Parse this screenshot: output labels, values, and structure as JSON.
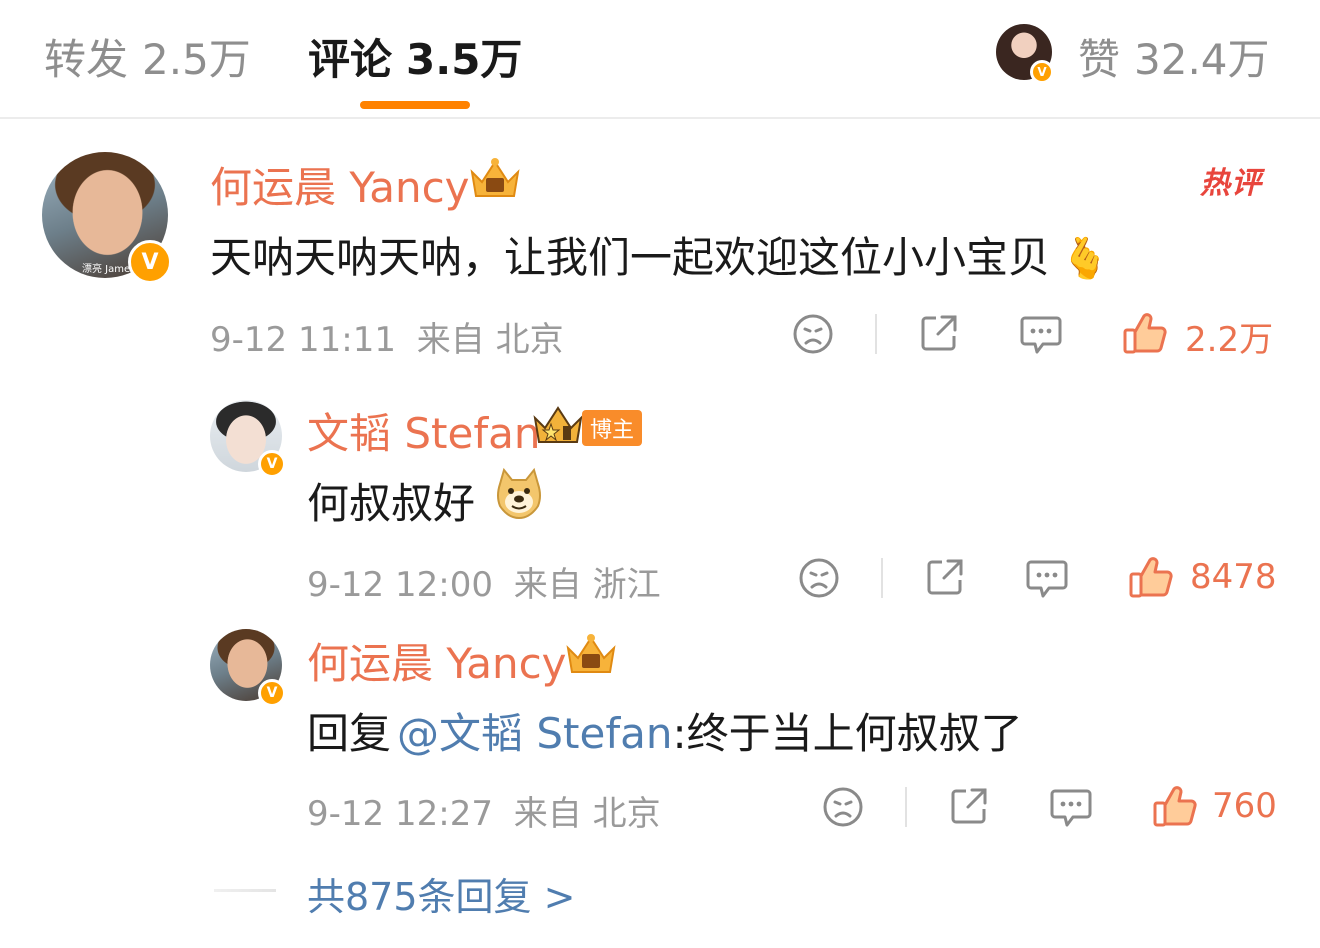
{
  "tabs": {
    "repost": {
      "label": "转发",
      "count": "2.5万"
    },
    "comment": {
      "label": "评论",
      "count": "3.5万"
    },
    "like": {
      "label": "赞",
      "count": "32.4万"
    }
  },
  "hot_label": "热评",
  "avatar_caption": "漂亮 James",
  "comments": [
    {
      "user": "何运晨 Yancy",
      "text": "天呐天呐天呐，让我们一起欢迎这位小小宝贝",
      "emoji": "🫰",
      "time": "9-12 11:11",
      "from": "来自 北京",
      "likes": "2.2万"
    },
    {
      "user": "文韬 Stefan",
      "tag": "博主",
      "text": "何叔叔好",
      "emoji": "doge",
      "time": "9-12 12:00",
      "from": "来自 浙江",
      "likes": "8478"
    },
    {
      "user": "何运晨 Yancy",
      "reply_prefix": "回复",
      "mention": "@文韬 Stefan",
      "text": ":终于当上何叔叔了",
      "time": "9-12 12:27",
      "from": "来自 北京",
      "likes": "760"
    }
  ],
  "more_replies": "共875条回复 >",
  "colors": {
    "accent_orange": "#ff8200",
    "username": "#eb7350",
    "link": "#507daf",
    "meta": "#9a9a9a",
    "hot": "#e8453c"
  }
}
